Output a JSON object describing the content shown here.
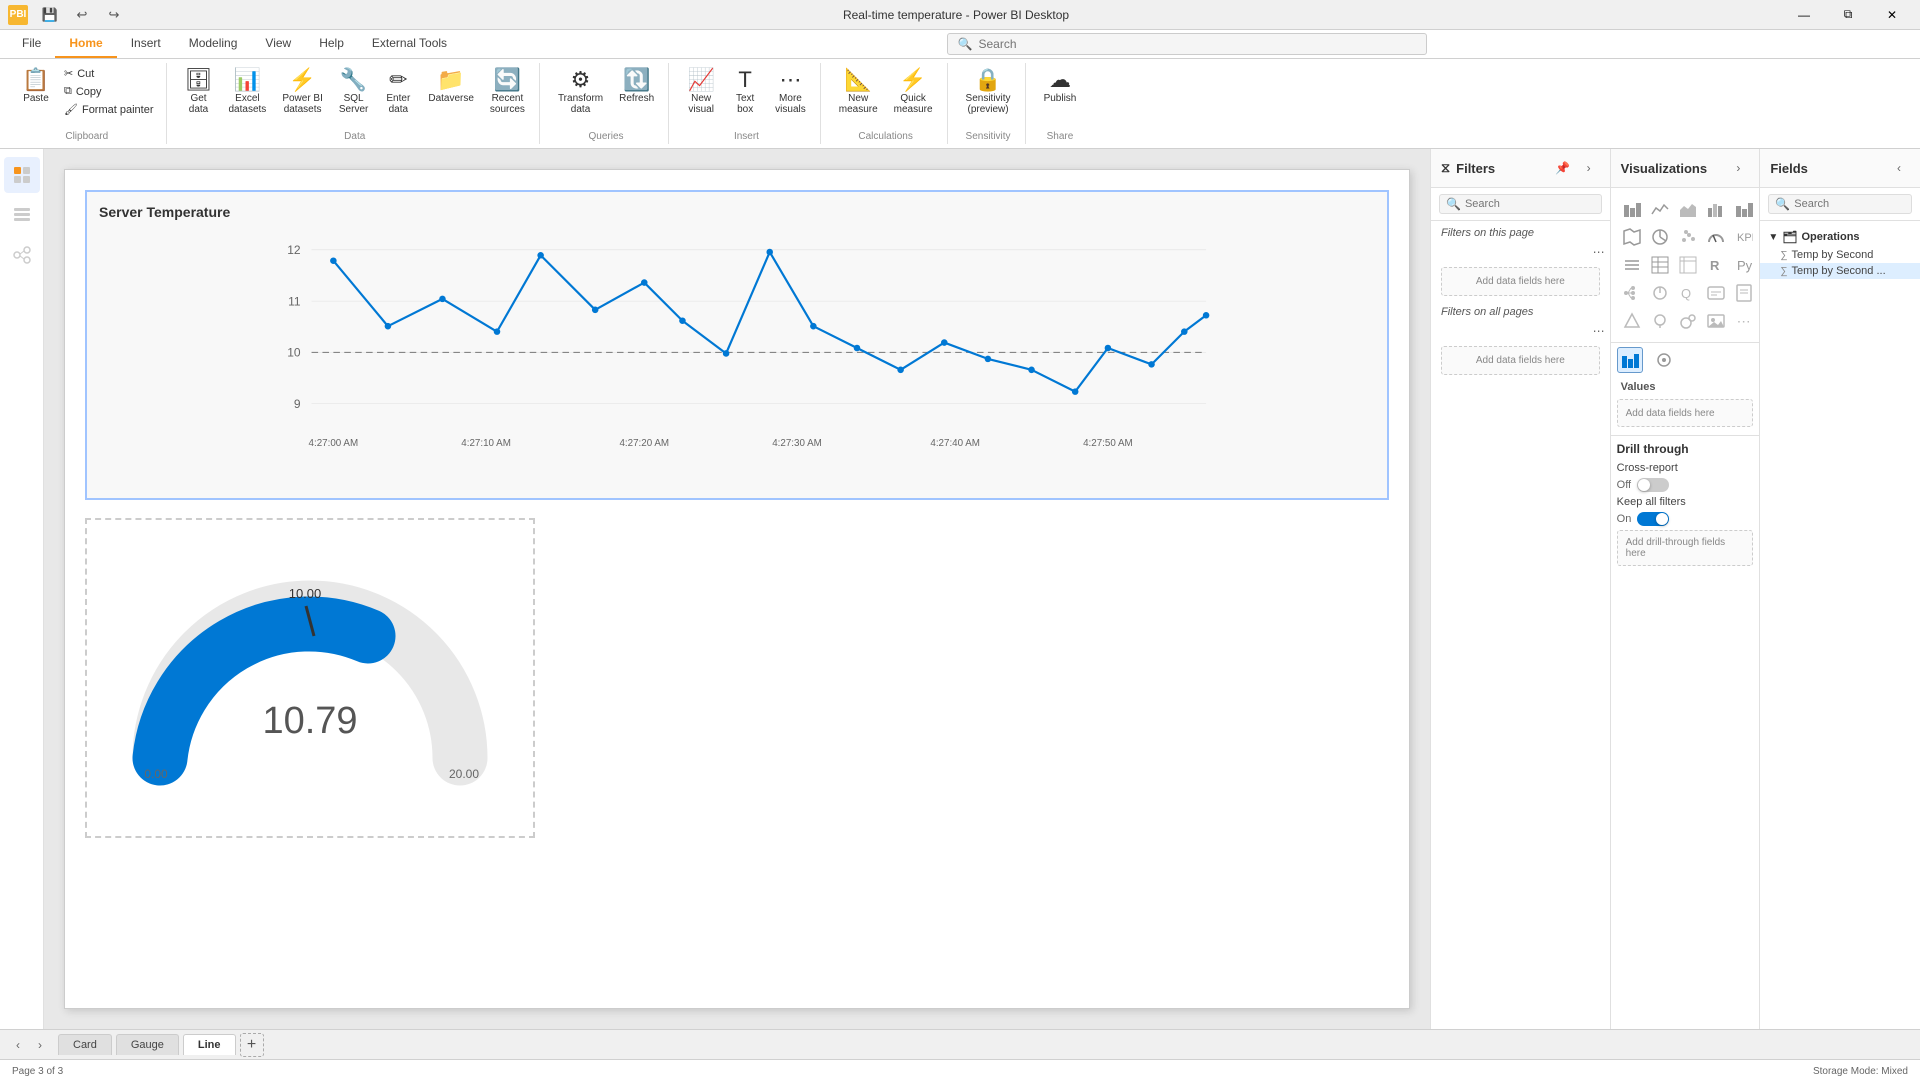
{
  "titlebar": {
    "title": "Real-time temperature - Power BI Desktop",
    "appIcon": "PBI",
    "quickAccess": [
      "💾",
      "↩",
      "↪"
    ],
    "controls": [
      "—",
      "⧉",
      "✕"
    ]
  },
  "ribbonTabs": [
    "File",
    "Home",
    "Insert",
    "Modeling",
    "View",
    "Help",
    "External Tools"
  ],
  "activeTab": "Home",
  "ribbon": {
    "groups": [
      {
        "label": "Clipboard",
        "items": [
          {
            "icon": "📋",
            "label": "Paste",
            "size": "large"
          },
          {
            "icon": "✂",
            "label": "Cut",
            "size": "small"
          },
          {
            "icon": "⧉",
            "label": "Copy",
            "size": "small"
          },
          {
            "icon": "🖌",
            "label": "Format painter",
            "size": "small"
          }
        ]
      },
      {
        "label": "Data",
        "items": [
          {
            "icon": "🗄",
            "label": "Get data",
            "size": "large"
          },
          {
            "icon": "📊",
            "label": "Excel datasets",
            "size": "large"
          },
          {
            "icon": "⚡",
            "label": "Power BI datasets",
            "size": "large"
          },
          {
            "icon": "🔧",
            "label": "SQL Server",
            "size": "large"
          },
          {
            "icon": "✏",
            "label": "Enter data",
            "size": "large"
          },
          {
            "icon": "📁",
            "label": "Dataverse",
            "size": "large"
          },
          {
            "icon": "🔄",
            "label": "Recent sources",
            "size": "large"
          }
        ]
      },
      {
        "label": "Queries",
        "items": [
          {
            "icon": "⚙",
            "label": "Transform data",
            "size": "large"
          },
          {
            "icon": "🔃",
            "label": "Refresh",
            "size": "large"
          }
        ]
      },
      {
        "label": "Insert",
        "items": [
          {
            "icon": "📈",
            "label": "New visual",
            "size": "large"
          },
          {
            "icon": "T",
            "label": "Text box",
            "size": "large"
          },
          {
            "icon": "⋯",
            "label": "More visuals",
            "size": "large"
          }
        ]
      },
      {
        "label": "Calculations",
        "items": [
          {
            "icon": "📐",
            "label": "New measure",
            "size": "large"
          },
          {
            "icon": "⚡",
            "label": "Quick measure",
            "size": "large"
          }
        ]
      },
      {
        "label": "Sensitivity",
        "items": [
          {
            "icon": "🔒",
            "label": "Sensitivity (preview)",
            "size": "large"
          }
        ]
      },
      {
        "label": "Share",
        "items": [
          {
            "icon": "☁",
            "label": "Publish",
            "size": "large"
          }
        ]
      }
    ]
  },
  "search": {
    "placeholder": "Search",
    "value": ""
  },
  "filters": {
    "title": "Filters",
    "search": {
      "placeholder": "Search",
      "value": ""
    },
    "sections": [
      {
        "label": "Filters on this page",
        "dropText": "Add data fields here",
        "moreText": "..."
      },
      {
        "label": "Filters on all pages",
        "dropText": "Add data fields here",
        "moreText": "..."
      }
    ]
  },
  "visualizations": {
    "title": "Visualizations",
    "icons": [
      "📊",
      "📉",
      "📋",
      "🗃",
      "📊",
      "🔢",
      "📈",
      "📉",
      "🗂",
      "🗺",
      "🔵",
      "🟦",
      "📐",
      "🎯",
      "⏺",
      "⏱",
      "🔤",
      "📝",
      "🖼",
      "⬜",
      "📌",
      "🔷",
      "💬",
      "🎛",
      "🔧",
      "📦",
      "🐍",
      "Ⓡ",
      "📌",
      "⬛",
      "🔗",
      "🔲",
      "💭",
      "🔑",
      "⊞",
      "📊"
    ],
    "buildSections": [
      {
        "title": "Values",
        "dropText": "Add data fields here"
      }
    ],
    "drillThrough": {
      "title": "Drill through",
      "crossReport": "Cross-report",
      "crossReportToggle": "off",
      "keepAllFilters": "Keep all filters",
      "keepAllFiltersToggle": "on",
      "dropText": "Add drill-through fields here"
    }
  },
  "fields": {
    "title": "Fields",
    "search": {
      "placeholder": "Search",
      "value": ""
    },
    "groups": [
      {
        "name": "Operations",
        "expanded": true,
        "items": [
          {
            "name": "Temp by Second",
            "selected": false
          },
          {
            "name": "Temp by Second ...",
            "selected": true
          }
        ]
      }
    ]
  },
  "chart": {
    "title": "Server Temperature",
    "yAxisValues": [
      "12",
      "11",
      "10",
      "9"
    ],
    "xAxisValues": [
      "4:27:00 AM",
      "4:27:10 AM",
      "4:27:20 AM",
      "4:27:30 AM",
      "4:27:40 AM",
      "4:27:50 AM"
    ],
    "dashLineValue": "10"
  },
  "gauge": {
    "value": "10.79",
    "minValue": "0.00",
    "maxValue": "20.00",
    "targetValue": "10.00"
  },
  "pages": [
    {
      "label": "Card",
      "active": false
    },
    {
      "label": "Gauge",
      "active": false
    },
    {
      "label": "Line",
      "active": true
    }
  ],
  "statusBar": {
    "pageInfo": "Page 3 of 3",
    "storageMode": "Storage Mode: Mixed"
  }
}
